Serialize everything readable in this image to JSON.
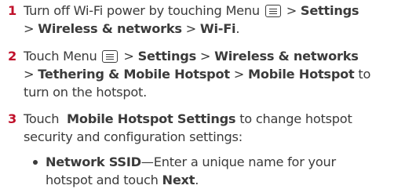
{
  "steps": [
    {
      "number": "1",
      "lines": [
        [
          "Turn off Wi-Fi power by touching Menu ",
          "ICON",
          " > ",
          "*Settings"
        ],
        [
          "> ",
          "*Wireless & networks",
          " > ",
          "*Wi-Fi",
          "."
        ]
      ]
    },
    {
      "number": "2",
      "lines": [
        [
          "Touch Menu ",
          "ICON",
          " > ",
          "*Settings",
          " > ",
          "*Wireless & networks"
        ],
        [
          "> ",
          "*Tethering & Mobile Hotspot",
          " > ",
          "*Mobile Hotspot",
          " to"
        ],
        [
          "turn on the hotspot."
        ]
      ]
    },
    {
      "number": "3",
      "lines": [
        [
          "Touch  ",
          "*Mobile Hotspot Settings",
          " to change hotspot"
        ],
        [
          "security and configuration settings:"
        ]
      ]
    }
  ],
  "bullets": [
    {
      "lines": [
        [
          "*Network SSID",
          "—Enter a unique name for your"
        ],
        [
          "hotspot and touch ",
          "*Next",
          "."
        ]
      ]
    }
  ],
  "icons": {
    "menu": "menu-icon"
  }
}
